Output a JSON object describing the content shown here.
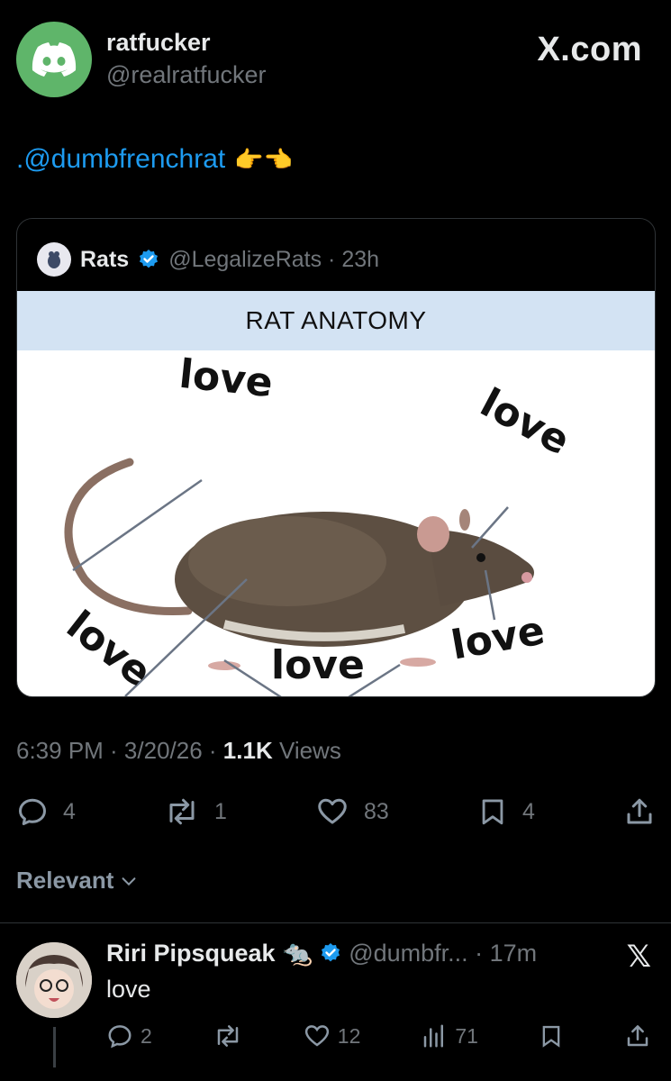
{
  "author": {
    "display_name": "ratfucker",
    "handle": "@realratfucker"
  },
  "site_logo": "X.com",
  "tweet": {
    "text": ".@dumbfrenchrat",
    "emoji": "👉👈"
  },
  "quote": {
    "name": "Rats",
    "handle_time": "@LegalizeRats · 23h",
    "image": {
      "banner_title": "RAT ANATOMY",
      "labels": [
        "love",
        "love",
        "love",
        "love",
        "love"
      ]
    }
  },
  "meta": {
    "time_date": "6:39 PM · 3/20/26 · ",
    "views_count": "1.1K",
    "views_label": " Views"
  },
  "actions": {
    "replies": "4",
    "reposts": "1",
    "likes": "83",
    "bookmarks": "4"
  },
  "sort_label": "Relevant",
  "reply": {
    "name": "Riri Pipsqueak",
    "name_emoji": "🐀",
    "handle_time": "@dumbfr... · 17m",
    "x_logo": "𝕏",
    "text": "love",
    "replies": "2",
    "likes": "12",
    "views": "71"
  },
  "colors": {
    "accent": "#1d9bf0",
    "verified": "#1d9bf0",
    "avatar_bg": "#5fb56a"
  }
}
